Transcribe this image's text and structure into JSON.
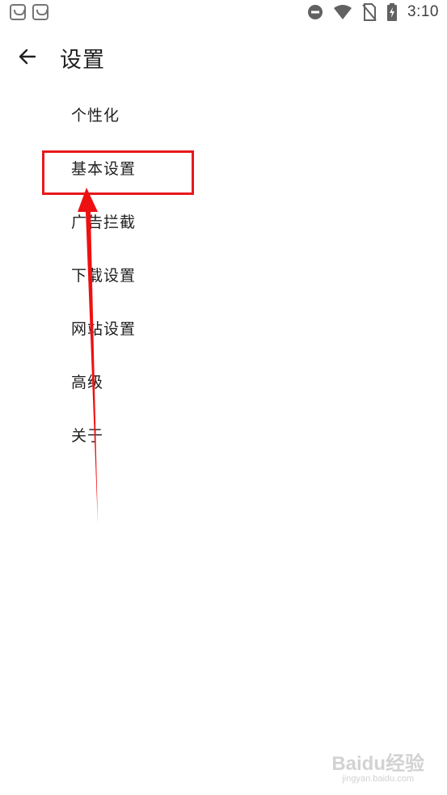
{
  "status_bar": {
    "time": "3:10",
    "icons": [
      "app-icon",
      "app-icon",
      "do-not-disturb-icon",
      "wifi-icon",
      "no-sim-icon",
      "battery-charging-icon"
    ]
  },
  "toolbar": {
    "back_icon": "arrow-left-icon",
    "title": "设置"
  },
  "settings": {
    "items": [
      {
        "label": "个性化"
      },
      {
        "label": "基本设置"
      },
      {
        "label": "广告拦截"
      },
      {
        "label": "下载设置"
      },
      {
        "label": "网站设置"
      },
      {
        "label": "高级"
      },
      {
        "label": "关于"
      }
    ]
  },
  "annotation": {
    "highlight_color": "#e8191c",
    "highlighted_item": "基本设置"
  },
  "watermark": {
    "logo": "Baidu经验",
    "url": "jingyan.baidu.com"
  }
}
